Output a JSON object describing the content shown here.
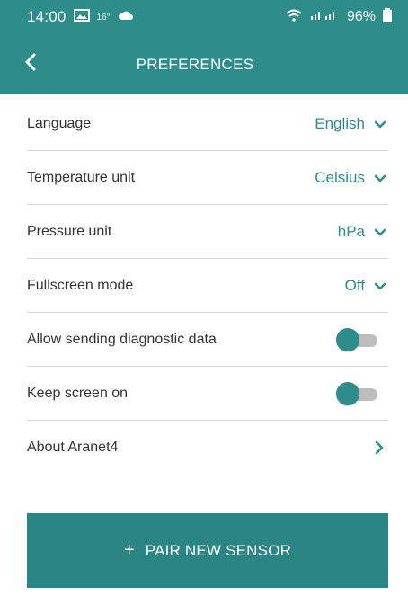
{
  "status": {
    "time": "14:00",
    "small": "16°",
    "battery": "96%"
  },
  "header": {
    "title": "PREFERENCES"
  },
  "settings": [
    {
      "label": "Language",
      "value": "English"
    },
    {
      "label": "Temperature unit",
      "value": "Celsius"
    },
    {
      "label": "Pressure unit",
      "value": "hPa"
    },
    {
      "label": "Fullscreen mode",
      "value": "Off"
    }
  ],
  "toggles": [
    {
      "label": "Allow sending diagnostic data"
    },
    {
      "label": "Keep screen on"
    }
  ],
  "about": {
    "label": "About Aranet4"
  },
  "pair": {
    "label": "PAIR NEW SENSOR",
    "plus": "+"
  },
  "colors": {
    "accent": "#2e8c8a"
  },
  "icons": [
    "back-arrow-icon",
    "chevron-down-icon",
    "chevron-right-icon",
    "plus-icon",
    "wifi-icon",
    "signal-icon",
    "battery-icon",
    "gallery-icon",
    "cloud-icon"
  ]
}
